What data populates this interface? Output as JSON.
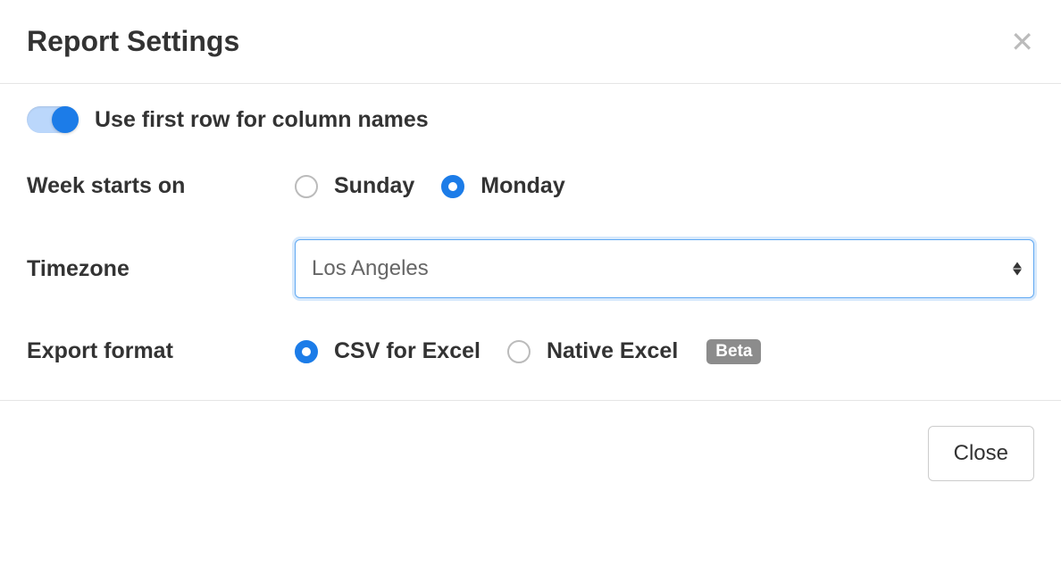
{
  "header": {
    "title": "Report Settings"
  },
  "toggle": {
    "label": "Use first row for column names",
    "enabled": true
  },
  "week": {
    "label": "Week starts on",
    "options": [
      "Sunday",
      "Monday"
    ],
    "selected": "Monday"
  },
  "timezone": {
    "label": "Timezone",
    "value": "Los Angeles"
  },
  "export": {
    "label": "Export format",
    "options": {
      "csv": "CSV for Excel",
      "native": "Native Excel"
    },
    "selected": "csv",
    "badge": "Beta"
  },
  "footer": {
    "close": "Close"
  }
}
